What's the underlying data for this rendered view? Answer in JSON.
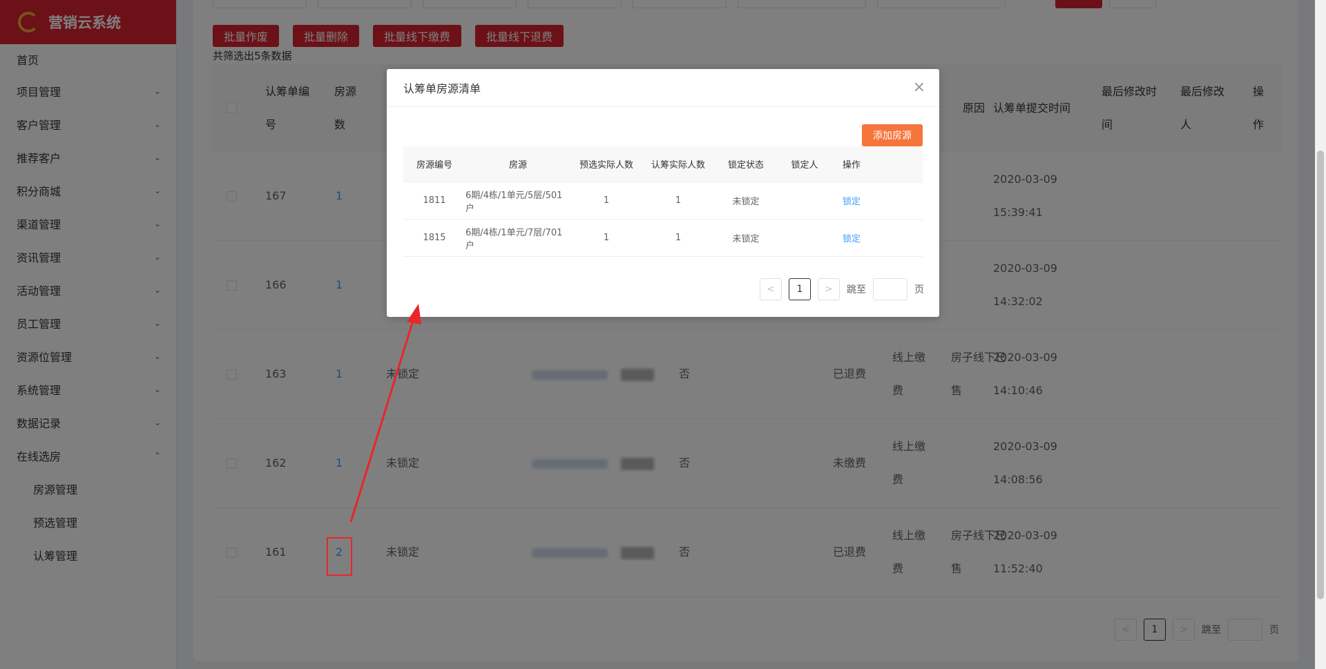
{
  "sidebar": {
    "brand": "营销云系统",
    "items": [
      {
        "label": "首页",
        "chevron": ""
      },
      {
        "label": "项目管理",
        "chevron": "⌄"
      },
      {
        "label": "客户管理",
        "chevron": "⌄"
      },
      {
        "label": "推荐客户",
        "chevron": "⌄"
      },
      {
        "label": "积分商城",
        "chevron": "⌄"
      },
      {
        "label": "渠道管理",
        "chevron": "⌄"
      },
      {
        "label": "资讯管理",
        "chevron": "⌄"
      },
      {
        "label": "活动管理",
        "chevron": "⌄"
      },
      {
        "label": "员工管理",
        "chevron": "⌄"
      },
      {
        "label": "资源位管理",
        "chevron": "⌄"
      },
      {
        "label": "系统管理",
        "chevron": "⌄"
      },
      {
        "label": "数据记录",
        "chevron": "⌄"
      },
      {
        "label": "在线选房",
        "chevron": "⌃"
      }
    ],
    "subitems": [
      "房源管理",
      "预选管理",
      "认筹管理"
    ]
  },
  "toolbar": {
    "batch_void": "批量作废",
    "batch_delete": "批量删除",
    "batch_offline_pay": "批量线下缴费",
    "batch_offline_refund": "批量线下退费",
    "count_text": "共筛选出5条数据"
  },
  "table": {
    "headers": {
      "id_line1": "认筹单编",
      "id_line2": "号",
      "house_count_line1": "房源",
      "house_count_line2": "数",
      "reason_partial": "原因",
      "submit_time": "认筹单提交时间",
      "modified_time_line1": "最后修改时",
      "modified_time_line2": "间",
      "modified_by_line1": "最后修改",
      "modified_by_line2": "人",
      "op_line1": "操",
      "op_line2": "作"
    },
    "rows": [
      {
        "id": "167",
        "house_count": "1",
        "lock": "",
        "refusal": "",
        "pay_status": "",
        "pay_way_1": "",
        "pay_way_2": "",
        "reason_1": "",
        "reason_2": "",
        "date": "2020-03-09",
        "time": "15:39:41"
      },
      {
        "id": "166",
        "house_count": "1",
        "lock": "",
        "refusal": "",
        "pay_status": "",
        "pay_way_1": "",
        "pay_way_2": "",
        "reason_1": "",
        "reason_2": "",
        "date": "2020-03-09",
        "time": "14:32:02"
      },
      {
        "id": "163",
        "house_count": "1",
        "lock": "未锁定",
        "refusal": "否",
        "pay_status": "已退费",
        "pay_way_1": "线上缴",
        "pay_way_2": "费",
        "reason_1": "房子线下已",
        "reason_2": "售",
        "date": "2020-03-09",
        "time": "14:10:46"
      },
      {
        "id": "162",
        "house_count": "1",
        "lock": "未锁定",
        "refusal": "否",
        "pay_status": "未缴费",
        "pay_way_1": "线上缴",
        "pay_way_2": "费",
        "reason_1": "",
        "reason_2": "",
        "date": "2020-03-09",
        "time": "14:08:56"
      },
      {
        "id": "161",
        "house_count": "2",
        "lock": "未锁定",
        "refusal": "否",
        "pay_status": "已退费",
        "pay_way_1": "线上缴",
        "pay_way_2": "费",
        "reason_1": "房子线下已",
        "reason_2": "售",
        "date": "2020-03-09",
        "time": "11:52:40"
      }
    ]
  },
  "pager": {
    "prev": "<",
    "page": "1",
    "next": ">",
    "jump_label": "跳至",
    "page_suffix": "页"
  },
  "dialog": {
    "title": "认筹单房源清单",
    "close": "×",
    "add_button": "添加房源",
    "headers": [
      "房源编号",
      "房源",
      "预选实际人数",
      "认筹实际人数",
      "锁定状态",
      "锁定人",
      "操作"
    ],
    "rows": [
      {
        "code": "1811",
        "house": "6期/4栋/1单元/5层/501户",
        "preselect": "1",
        "subscribe": "1",
        "lock_status": "未锁定",
        "locker": "",
        "action": "锁定"
      },
      {
        "code": "1815",
        "house": "6期/4栋/1单元/7层/701户",
        "preselect": "1",
        "subscribe": "1",
        "lock_status": "未锁定",
        "locker": "",
        "action": "锁定"
      }
    ],
    "pager": {
      "prev": "<",
      "page": "1",
      "next": ">",
      "jump_label": "跳至",
      "page_suffix": "页"
    }
  },
  "colors": {
    "brand_red": "#d9232e",
    "accent_orange": "#f5753b",
    "link_blue": "#409eff",
    "annotation_red": "#e8262b"
  }
}
